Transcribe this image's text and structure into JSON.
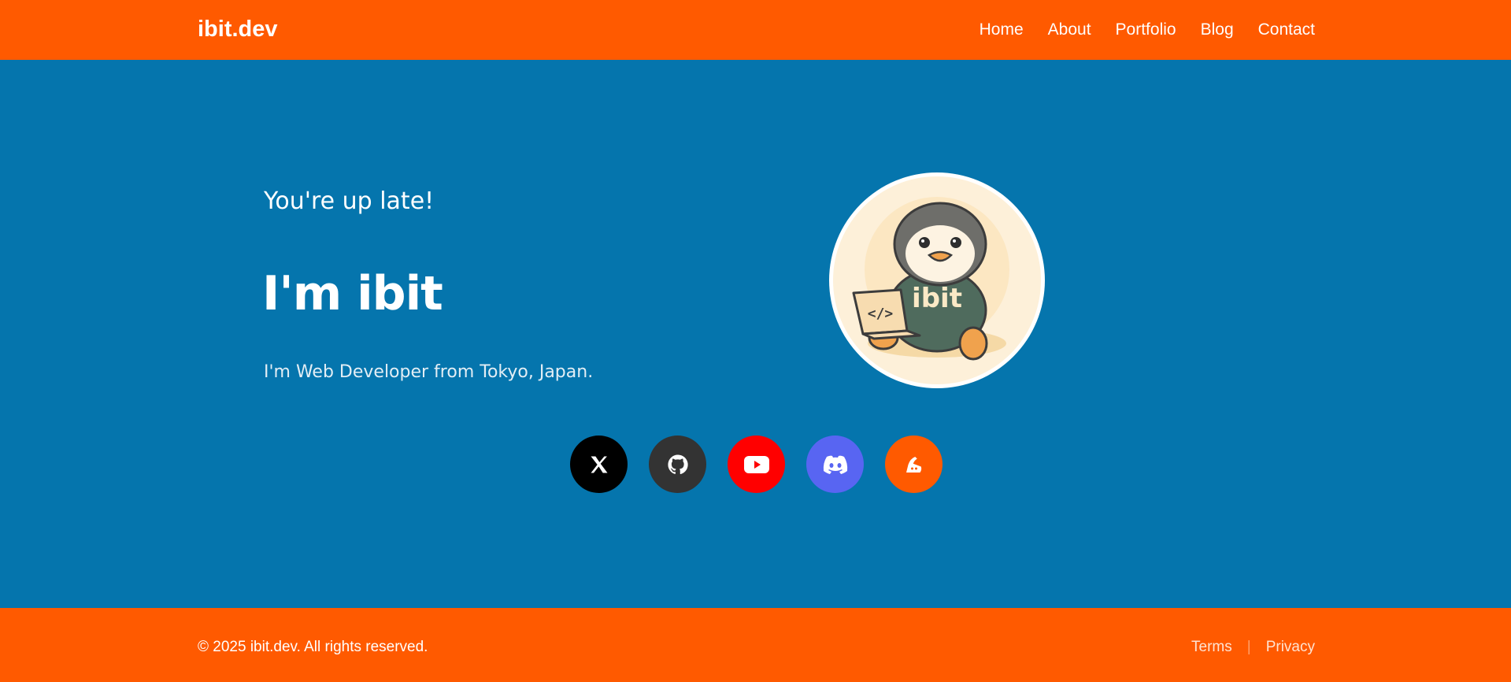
{
  "header": {
    "brand": "ibit.dev",
    "nav": [
      "Home",
      "About",
      "Portfolio",
      "Blog",
      "Contact"
    ]
  },
  "hero": {
    "greeting": "You're up late!",
    "name": "I'm ibit",
    "tagline": "I'm Web Developer from Tokyo, Japan.",
    "avatar_label": "ibit",
    "avatar_icon": "penguin-avatar"
  },
  "social": [
    {
      "icon": "x-icon",
      "color": "#000000"
    },
    {
      "icon": "github-icon",
      "color": "#333333"
    },
    {
      "icon": "youtube-icon",
      "color": "#ff0000"
    },
    {
      "icon": "discord-icon",
      "color": "#5865f2"
    },
    {
      "icon": "blog-icon",
      "color": "#ff5a00"
    }
  ],
  "footer": {
    "copyright": "© 2025 ibit.dev. All rights reserved.",
    "links": [
      "Terms",
      "Privacy"
    ],
    "separator": "|"
  },
  "colors": {
    "accent": "#ff5a00",
    "background": "#0575ad"
  }
}
